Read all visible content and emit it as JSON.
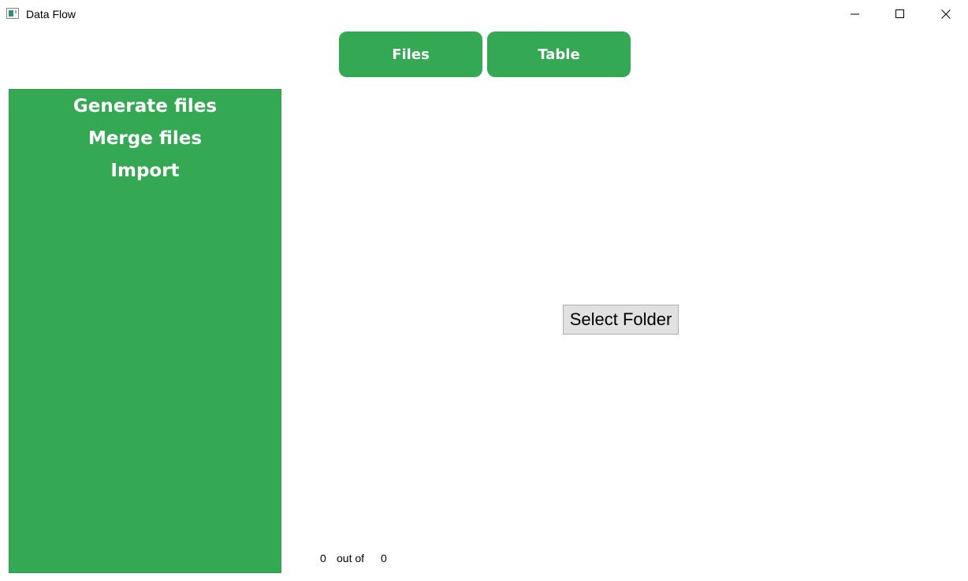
{
  "window": {
    "title": "Data Flow",
    "controls": [
      "minimize-icon",
      "maximize-icon",
      "close-icon"
    ]
  },
  "nav": {
    "files_label": "Files",
    "table_label": "Table"
  },
  "sidebar": {
    "items": [
      {
        "label": "Generate files"
      },
      {
        "label": "Merge files"
      },
      {
        "label": "Import"
      }
    ]
  },
  "main": {
    "select_folder_label": "Select Folder"
  },
  "progress": {
    "current": "0",
    "separator": "out of",
    "total": "0"
  },
  "colors": {
    "accent": "#34a853",
    "button_gray": "#e1e1e1"
  }
}
